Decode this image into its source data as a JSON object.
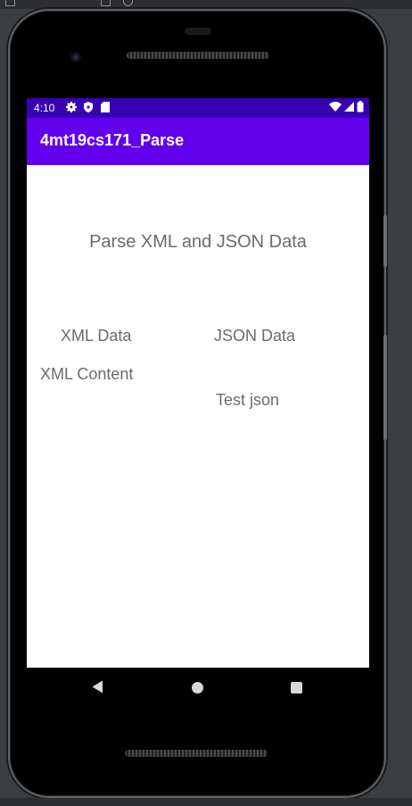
{
  "status_bar": {
    "time": "4:10",
    "left_icons": [
      "gear-icon",
      "shield-icon",
      "sd-card-icon"
    ],
    "right_icons": [
      "wifi-icon",
      "signal-icon",
      "battery-icon"
    ],
    "color": "#3700b3"
  },
  "app_bar": {
    "title": "4mt19cs171_Parse",
    "color": "#6200ee"
  },
  "content": {
    "heading": "Parse XML and JSON Data",
    "xml_label": "XML Data",
    "json_label": "JSON Data",
    "xml_content": "XML Content",
    "json_content": "Test json"
  },
  "nav_bar": {
    "buttons": [
      "back-icon",
      "home-icon",
      "recents-icon"
    ]
  }
}
